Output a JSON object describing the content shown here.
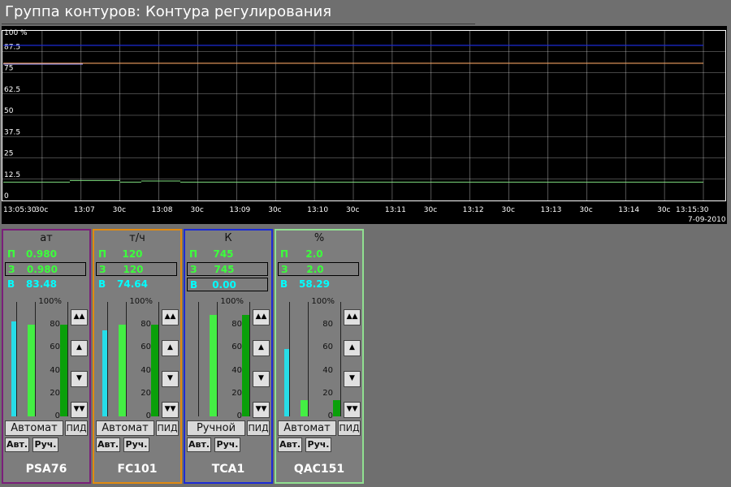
{
  "title": "Группа контуров: Контура регулирования",
  "trend": {
    "y_ticks": [
      "100 %",
      "87.5",
      "75",
      "62.5",
      "50",
      "37.5",
      "25",
      "12.5",
      "0"
    ],
    "x_ticks": [
      "13:05:30",
      "30с",
      "13:07",
      "30с",
      "13:08",
      "30с",
      "13:09",
      "30с",
      "13:10",
      "30с",
      "13:11",
      "30с",
      "13:12",
      "30с",
      "13:13",
      "30с",
      "13:14",
      "30с",
      "13:15:30"
    ],
    "date": "7-09-2010",
    "line_colors": [
      "#1c2bd6",
      "#f0a060",
      "#9a9aff",
      "#80e080"
    ]
  },
  "panels": [
    {
      "name": "PSA76",
      "unit": "ат",
      "border": "#7a1f7a",
      "p_label": "П",
      "p_value": "0.980",
      "z_label": "З",
      "z_value": "0.980",
      "v_label": "В",
      "v_value": "83.48",
      "z_color": "#3cff3c",
      "v_color": "#00ffff",
      "mode": "Автомат",
      "pid": "ПИД",
      "auto_btn": "Авт.",
      "manual_btn": "Руч.",
      "bar_cyan": 83,
      "bar_green": 80,
      "bar_darkgreen": 80
    },
    {
      "name": "FC101",
      "unit": "т/ч",
      "border": "#e08a10",
      "p_label": "П",
      "p_value": "120",
      "z_label": "З",
      "z_value": "120",
      "v_label": "В",
      "v_value": "74.64",
      "z_color": "#3cff3c",
      "v_color": "#00ffff",
      "mode": "Автомат",
      "pid": "ПИД",
      "auto_btn": "Авт.",
      "manual_btn": "Руч.",
      "bar_cyan": 75,
      "bar_green": 80,
      "bar_darkgreen": 80
    },
    {
      "name": "TCA1",
      "unit": "К",
      "border": "#1c2bd6",
      "p_label": "П",
      "p_value": "745",
      "z_label": "З",
      "z_value": "745",
      "v_label": "В",
      "v_value": "0.00",
      "z_color": "#3cff3c",
      "v_color": "#00ffff",
      "mode": "Ручной",
      "pid": "ПИД",
      "auto_btn": "Авт.",
      "manual_btn": "Руч.",
      "bar_cyan": 0,
      "bar_green": 89,
      "bar_darkgreen": 89
    },
    {
      "name": "QAC151",
      "unit": "%",
      "border": "#90e090",
      "p_label": "П",
      "p_value": "2.0",
      "z_label": "З",
      "z_value": "2.0",
      "v_label": "В",
      "v_value": "58.29",
      "z_color": "#3cff3c",
      "v_color": "#00ffff",
      "mode": "Автомат",
      "pid": "ПИД",
      "auto_btn": "Авт.",
      "manual_btn": "Руч.",
      "bar_cyan": 59,
      "bar_green": 14,
      "bar_darkgreen": 14
    }
  ],
  "scale": [
    "100%",
    "80",
    "60",
    "40",
    "20",
    "0"
  ]
}
